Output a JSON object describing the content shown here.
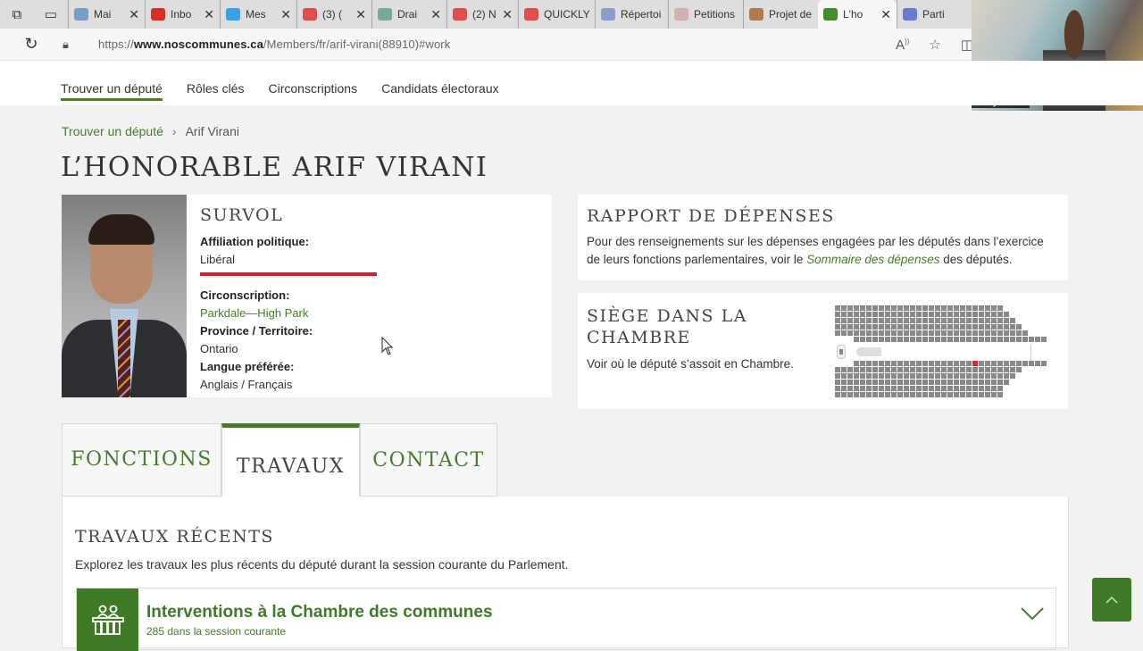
{
  "browser": {
    "tabs": [
      {
        "title": "Mai",
        "icon": "mail-icon",
        "color": "#7a9cc6"
      },
      {
        "title": "Inbo",
        "icon": "gmail-icon",
        "color": "#d93025"
      },
      {
        "title": "Mes",
        "icon": "skype-icon",
        "color": "#3aa0e8"
      },
      {
        "title": "(3) (",
        "icon": "youtube-icon",
        "color": "#e05050"
      },
      {
        "title": "Drai",
        "icon": "sync-icon",
        "color": "#7aa6a0"
      },
      {
        "title": "(2) N",
        "icon": "youtube-icon",
        "color": "#e05050"
      },
      {
        "title": "QUICKLY",
        "icon": "youtube-icon",
        "color": "#e05050"
      },
      {
        "title": "Répertoi",
        "icon": "f-icon",
        "color": "#8aa0c8"
      },
      {
        "title": "Petitions",
        "icon": "petition-icon",
        "color": "#d0b0b0"
      },
      {
        "title": "Projet de",
        "icon": "parliament-icon",
        "color": "#b07a50"
      },
      {
        "title": "L'ho",
        "icon": "noscommunes-icon",
        "color": "#4a8a2a",
        "active": true
      },
      {
        "title": "Particip",
        "icon": "zoom-icon",
        "color": "#6a7ad0"
      }
    ],
    "url_prefix": "https://",
    "url_domain": "www.noscommunes.ca",
    "url_path": "/Members/fr/arif-virani(88910)#work"
  },
  "webcam": {
    "name": "Lady Rose"
  },
  "sitenav": {
    "items": [
      "Trouver un député",
      "Rôles clés",
      "Circonscriptions",
      "Candidats électoraux"
    ],
    "active": 0
  },
  "breadcrumb": {
    "parent": "Trouver un député",
    "separator": "›",
    "current": "Arif Virani"
  },
  "page_title": "L’HONORABLE ARIF VIRANI",
  "overview": {
    "title": "SURVOL",
    "affiliation_label": "Affiliation politique:",
    "affiliation_value": "Libéral",
    "party_color": "#d71f2e",
    "riding_label": "Circonscription:",
    "riding_value": "Parkdale—High Park",
    "province_label": "Province / Territoire:",
    "province_value": "Ontario",
    "language_label": "Langue préférée:",
    "language_value": "Anglais / Français"
  },
  "expenses": {
    "title": "RAPPORT DE DÉPENSES",
    "text_before": "Pour des renseignements sur les dépenses engagées par les députés dans l’exercice de leurs fonctions parlementaires, voir le ",
    "link": "Sommaire des dépenses",
    "text_after": " des députés."
  },
  "seat": {
    "title": "SIÈGE DANS LA CHAMBRE",
    "text": "Voir où le député s’assoit en Chambre.",
    "highlight_color": "#e0242e"
  },
  "tabs": [
    "FONCTIONS",
    "TRAVAUX",
    "CONTACT"
  ],
  "active_tab": 1,
  "work": {
    "title": "TRAVAUX RÉCENTS",
    "description": "Explorez les travaux les plus récents du député durant la session courante du Parlement.",
    "sections": [
      {
        "title": "Interventions à la Chambre des communes",
        "subtitle": "285 dans la session courante",
        "icon": "house-interventions-icon"
      }
    ]
  },
  "colors": {
    "accent": "#3f7a26",
    "link": "#4a7a2e"
  }
}
